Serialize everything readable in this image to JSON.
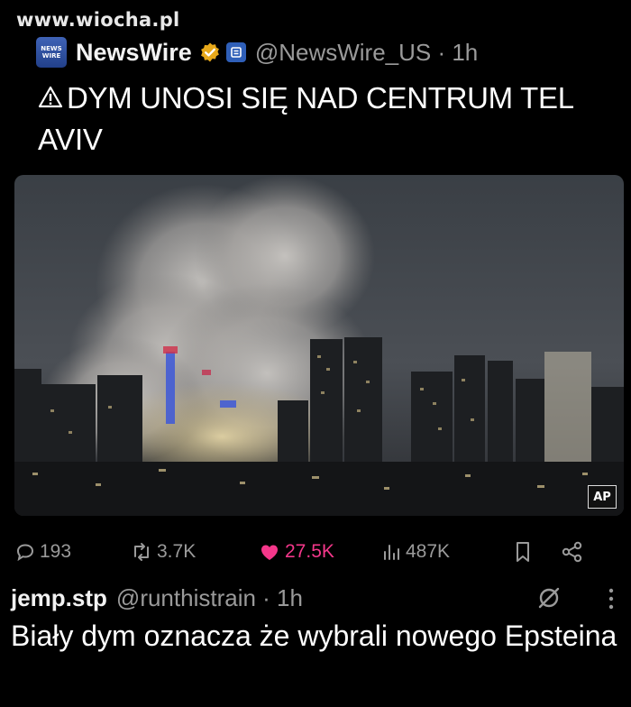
{
  "watermark": "www.wiocha.pl",
  "post": {
    "avatar_text": [
      "NEWS",
      "WIRE"
    ],
    "author": "NewsWire",
    "handle_time": "@NewsWire_US · 1h",
    "headline": "DYM UNOSI SIĘ NAD CENTRUM TEL AVIV",
    "media_credit": "AP"
  },
  "actions": {
    "replies": "193",
    "reposts": "3.7K",
    "likes": "27.5K",
    "views": "487K"
  },
  "reply": {
    "author": "jemp.stp",
    "handle_time": "@runthistrain · 1h",
    "text": "Biały dym oznacza że wybrali nowego Epsteina"
  },
  "colors": {
    "background": "#000000",
    "secondary_text": "#9a9a9a",
    "like": "#f4378a",
    "verified_gold": "#e8a91a"
  }
}
